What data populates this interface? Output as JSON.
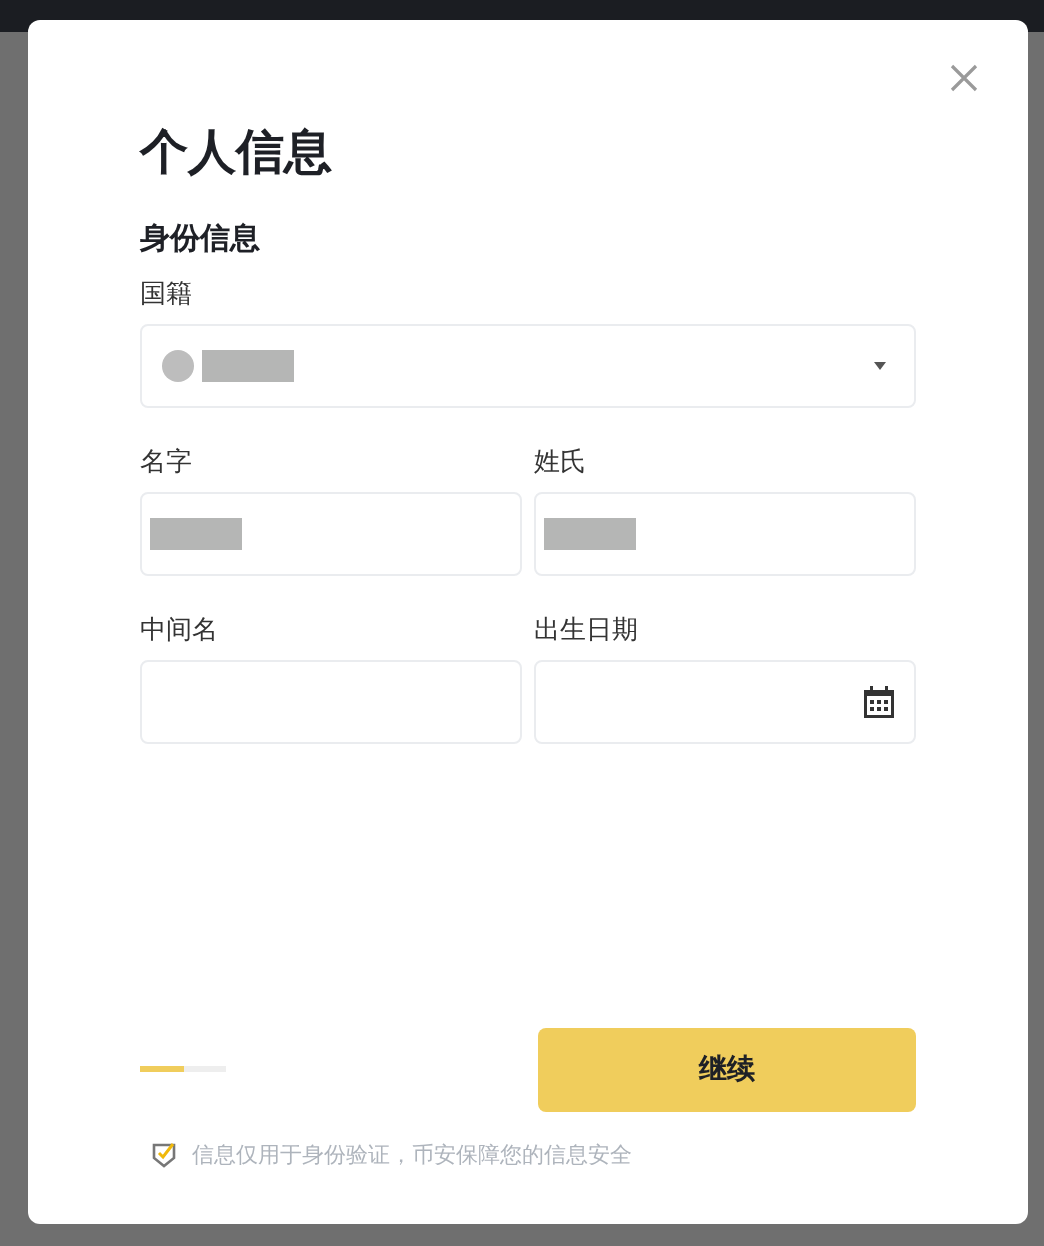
{
  "dialog": {
    "title": "个人信息",
    "section_title": "身份信息",
    "fields": [
      {
        "kind": "select",
        "label": "国籍",
        "redacted": true
      },
      {
        "kind": "text",
        "label": "名字",
        "redacted": true
      },
      {
        "kind": "text",
        "label": "姓氏",
        "redacted": true
      },
      {
        "kind": "text",
        "label": "中间名",
        "redacted": false
      },
      {
        "kind": "date",
        "label": "出生日期",
        "redacted": false
      }
    ],
    "progress": {
      "level": 0.5
    },
    "continue_button": "继续",
    "notice": "信息仅用于身份验证，币安保障您的信息安全"
  }
}
